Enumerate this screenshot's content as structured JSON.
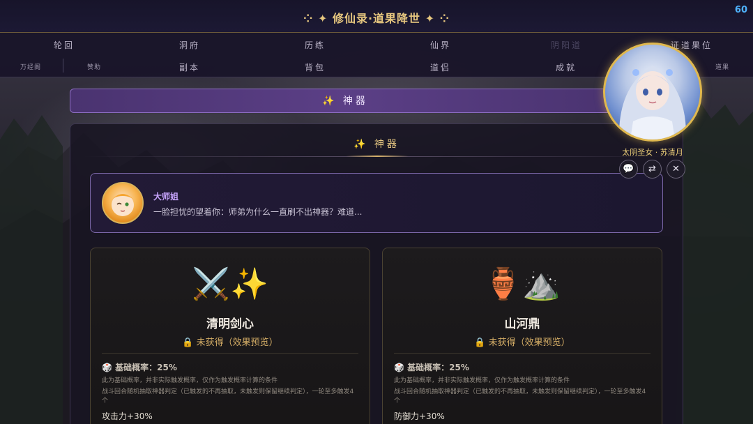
{
  "header": {
    "title": "⁘ ✦ 修仙录·道果降世 ✦ ⁘",
    "fps": "60"
  },
  "nav": {
    "row1": [
      "轮回",
      "洞府",
      "历练",
      "仙界",
      "阴阳道",
      "证道果位"
    ],
    "row2_small": [
      "万经阁",
      "赞助"
    ],
    "row2": [
      "副本",
      "背包",
      "道侣",
      "成就"
    ],
    "row2_right_small": "道果"
  },
  "banner": {
    "label": "✨ 神器"
  },
  "panel": {
    "title": "✨ 神器",
    "dialog": {
      "speaker": "大师姐",
      "line": "一脸担忧的望着你：师弟为什么一直刷不出神器？难道..."
    },
    "cards": [
      {
        "icons": "⚔️✨",
        "name": "清明剑心",
        "status": "🔒 未获得（效果预览）",
        "rate": "🎲 基础概率：25%",
        "desc1": "此为基础概率，并非实际触发概率，仅作为触发概率计算的条件",
        "desc2": "战斗回合随机抽取神器判定（已触发的不再抽取，未触发则保留继续判定），一轮至多触发4个",
        "effect": "攻击力+30%"
      },
      {
        "icons": "🏺⛰️",
        "name": "山河鼎",
        "status": "🔒 未获得（效果预览）",
        "rate": "🎲 基础概率：25%",
        "desc1": "此为基础概率，并非实际触发概率，仅作为触发概率计算的条件",
        "desc2": "战斗回合随机抽取神器判定（已触发的不再抽取，未触发则保留继续判定），一轮至多触发4个",
        "effect": "防御力+30%"
      }
    ]
  },
  "character": {
    "name": "太阴圣女 · 苏清月",
    "buttons": {
      "chat": "💬",
      "swap": "⇄",
      "close": "✕"
    }
  },
  "colors": {
    "gold": "#e7c77f",
    "purple": "#5b3f86",
    "fps": "#4fb3ff"
  }
}
